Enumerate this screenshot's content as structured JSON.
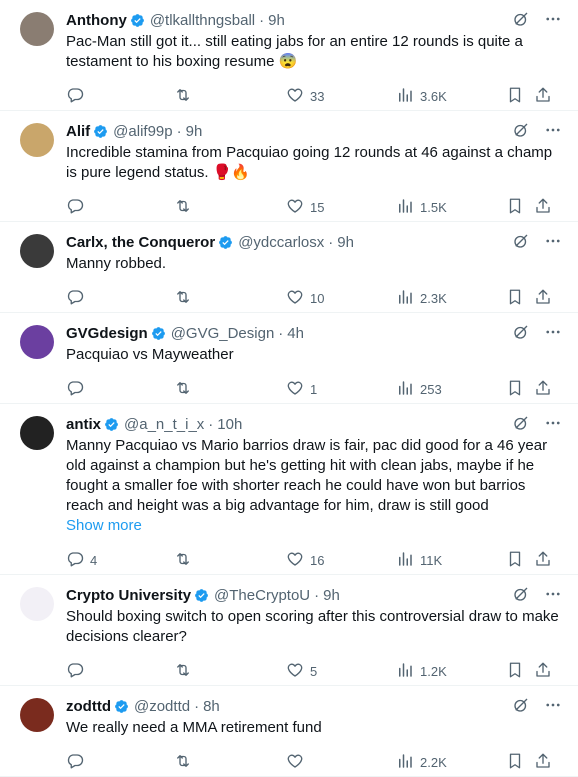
{
  "tweets": [
    {
      "name": "Anthony",
      "handle": "@tlkallthngsball",
      "time": "9h",
      "text": "Pac-Man still got it... still eating jabs for an entire 12 rounds is quite a testament to his boxing resume 😨",
      "replies": "",
      "retweets": "",
      "likes": "33",
      "views": "3.6K",
      "avatar_color": "#8a7d72"
    },
    {
      "name": "Alif",
      "handle": "@alif99p",
      "time": "9h",
      "text": "Incredible stamina from Pacquiao going 12 rounds at 46 against a champ is pure legend status. 🥊🔥",
      "replies": "",
      "retweets": "",
      "likes": "15",
      "views": "1.5K",
      "avatar_color": "#c9a66b"
    },
    {
      "name": "Carlx, the Conqueror",
      "handle": "@ydccarlosx",
      "time": "9h",
      "text": "Manny robbed.",
      "replies": "",
      "retweets": "",
      "likes": "10",
      "views": "2.3K",
      "avatar_color": "#3a3a3a"
    },
    {
      "name": "GVGdesign",
      "handle": "@GVG_Design",
      "time": "4h",
      "text": "Pacquiao  vs Mayweather",
      "replies": "",
      "retweets": "",
      "likes": "1",
      "views": "253",
      "avatar_color": "#6b3fa0"
    },
    {
      "name": "antix",
      "handle": "@a_n_t_i_x",
      "time": "10h",
      "text": "Manny Pacquiao vs Mario barrios draw is fair, pac did good for a 46 year old against a champion but he's getting hit with clean jabs, maybe if he fought a smaller foe with shorter reach he could have won but barrios reach and height was a big advantage for him, draw is still good",
      "show_more": "Show more",
      "replies": "4",
      "retweets": "",
      "likes": "16",
      "views": "11K",
      "avatar_color": "#222222"
    },
    {
      "name": "Crypto University",
      "handle": "@TheCryptoU",
      "time": "9h",
      "text": "Should boxing switch to open scoring after this controversial draw to make decisions clearer?",
      "replies": "",
      "retweets": "",
      "likes": "5",
      "views": "1.2K",
      "avatar_color": "#f2f0f6"
    },
    {
      "name": "zodttd",
      "handle": "@zodttd",
      "time": "8h",
      "text": "We really need a MMA retirement fund",
      "replies": "",
      "retweets": "",
      "likes": "",
      "views": "2.2K",
      "avatar_color": "#7a2b1e"
    }
  ],
  "icons": {
    "verified": "verified-badge-icon",
    "grok": "grok-icon",
    "more": "more-icon",
    "reply": "reply-icon",
    "retweet": "retweet-icon",
    "like": "heart-icon",
    "views": "views-icon",
    "bookmark": "bookmark-icon",
    "share": "share-icon"
  },
  "colors": {
    "verified": "#1d9bf0",
    "muted": "#536471",
    "link": "#1d9bf0",
    "divider": "#eff3f4"
  }
}
